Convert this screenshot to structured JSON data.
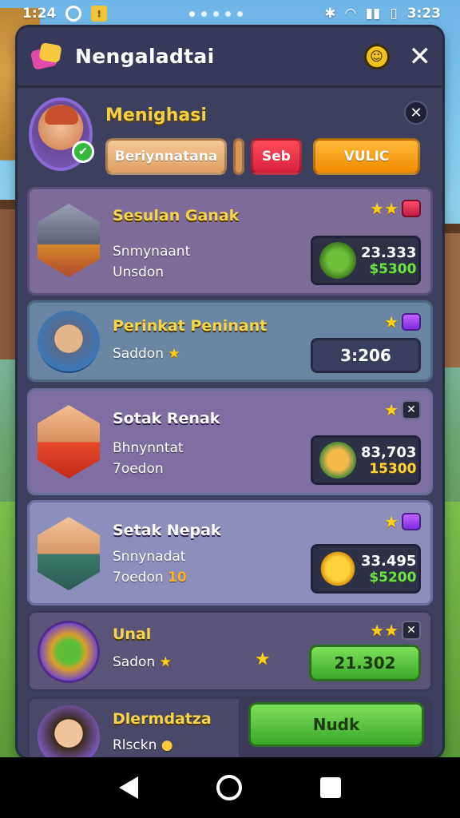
{
  "status_bar": {
    "time": "1:24",
    "right_time": "3:23",
    "badge_icon": "notification-square-icon"
  },
  "header": {
    "title": "Nengaladtai",
    "icon": "gift-cards-icon",
    "smile_icon": "smiley-icon",
    "close_icon": "close-icon"
  },
  "profile": {
    "name": "Menighasi",
    "buttons": {
      "primary": "Beriynnatana",
      "secondary": "Seb",
      "action": "VULIC"
    },
    "close_label": "✕"
  },
  "items": [
    {
      "name": "Sesulan Ganak",
      "sub1": "Snmynaant",
      "sub2": "Unsdon",
      "value": "23.333",
      "price": "$5300",
      "stars": "★★",
      "corner": "red-gem"
    },
    {
      "name": "Perinkat Peninant",
      "sub1": "Saddon",
      "sub1_extra": "★",
      "timer": "3:206",
      "stars": "★",
      "corner": "purple-gem"
    },
    {
      "name": "Sotak Renak",
      "sub1": "Bhnynntat",
      "sub2": "7oedon",
      "value": "83,703",
      "price": "15300",
      "stars": "★",
      "corner": "close"
    },
    {
      "name": "Setak Nepak",
      "sub1": "Snnynadat",
      "sub2": "7oedon",
      "sub2_extra": "10",
      "value": "33.495",
      "price": "$5200",
      "stars": "★",
      "corner": "purple-gem"
    },
    {
      "name": "Unal",
      "sub1": "Sadon",
      "sub1_extra": "★",
      "mid_star": "★",
      "button": "21.302",
      "stars": "★★",
      "corner": "close"
    },
    {
      "name": "Dlermdatza",
      "sub1": "Rlsckn",
      "button": "Nudk"
    }
  ],
  "colors": {
    "panel": "#3d3f5e",
    "gold_text": "#f6d54a",
    "green_button": "#5ac43a",
    "orange_button": "#f7a419",
    "red_button": "#e8324a"
  }
}
